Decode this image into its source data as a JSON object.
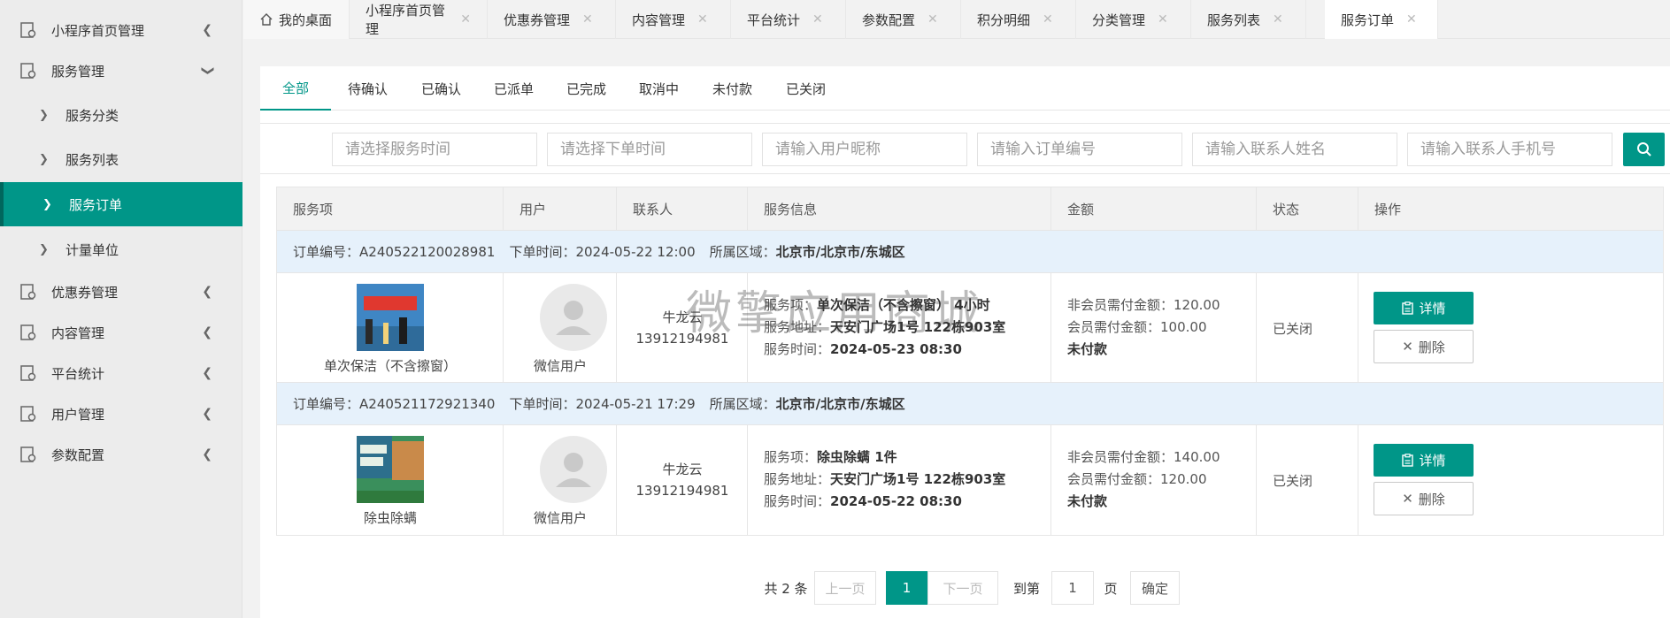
{
  "sidebar": {
    "items": [
      {
        "label": "小程序首页管理",
        "expanded": false
      },
      {
        "label": "服务管理",
        "expanded": true
      },
      {
        "label": "优惠券管理",
        "expanded": false
      },
      {
        "label": "内容管理",
        "expanded": false
      },
      {
        "label": "平台统计",
        "expanded": false
      },
      {
        "label": "用户管理",
        "expanded": false
      },
      {
        "label": "参数配置",
        "expanded": false
      }
    ],
    "sub_items": [
      {
        "label": "服务分类"
      },
      {
        "label": "服务列表"
      },
      {
        "label": "服务订单",
        "active": true
      },
      {
        "label": "计量单位"
      }
    ]
  },
  "tabs": [
    {
      "label": "我的桌面",
      "home": true
    },
    {
      "label": "小程序首页管理"
    },
    {
      "label": "优惠券管理"
    },
    {
      "label": "内容管理"
    },
    {
      "label": "平台统计"
    },
    {
      "label": "参数配置"
    },
    {
      "label": "积分明细"
    },
    {
      "label": "分类管理"
    },
    {
      "label": "服务列表"
    },
    {
      "label": "服务订单",
      "active": true
    }
  ],
  "status_tabs": [
    "全部",
    "待确认",
    "已确认",
    "已派单",
    "已完成",
    "取消中",
    "未付款",
    "已关闭"
  ],
  "search": {
    "placeholders": [
      "请选择服务时间",
      "请选择下单时间",
      "请输入用户昵称",
      "请输入订单编号",
      "请输入联系人姓名",
      "请输入联系人手机号"
    ]
  },
  "table": {
    "headers": [
      "服务项",
      "用户",
      "联系人",
      "服务信息",
      "金额",
      "状态",
      "操作"
    ]
  },
  "orders": [
    {
      "order_no_label": "订单编号：",
      "order_no": "A240522120028981",
      "order_time_label": "下单时间：",
      "order_time": "2024-05-22 12:00",
      "region_label": "所属区域：",
      "region": "北京市/北京市/东城区",
      "service_name": "单次保洁（不含擦窗）",
      "user_name": "微信用户",
      "contact_name": "牛龙云",
      "contact_phone": "13912194981",
      "svc_item_label": "服务项：",
      "svc_item": "单次保洁（不含擦窗）  4小时",
      "svc_addr_label": "服务地址：",
      "svc_addr": "天安门广场1号  122栋903室",
      "svc_time_label": "服务时间：",
      "svc_time": "2024-05-23 08:30",
      "non_member_label": "非会员需付金额：",
      "non_member": "120.00",
      "member_label": "会员需付金额：",
      "member": "100.00",
      "pay_status": "未付款",
      "status": "已关闭",
      "detail_label": "详情",
      "delete_label": "删除"
    },
    {
      "order_no_label": "订单编号：",
      "order_no": "A240521172921340",
      "order_time_label": "下单时间：",
      "order_time": "2024-05-21 17:29",
      "region_label": "所属区域：",
      "region": "北京市/北京市/东城区",
      "service_name": "除虫除螨",
      "user_name": "微信用户",
      "contact_name": "牛龙云",
      "contact_phone": "13912194981",
      "svc_item_label": "服务项：",
      "svc_item": "除虫除螨  1件",
      "svc_addr_label": "服务地址：",
      "svc_addr": "天安门广场1号  122栋903室",
      "svc_time_label": "服务时间：",
      "svc_time": "2024-05-22 08:30",
      "non_member_label": "非会员需付金额：",
      "non_member": "140.00",
      "member_label": "会员需付金额：",
      "member": "120.00",
      "pay_status": "未付款",
      "status": "已关闭",
      "detail_label": "详情",
      "delete_label": "删除"
    }
  ],
  "pagination": {
    "total": "共 2 条",
    "prev": "上一页",
    "current": "1",
    "next": "下一页",
    "goto_label": "到第",
    "goto_value": "1",
    "page_unit": "页",
    "confirm": "确定"
  },
  "watermark": "微擎应用商城",
  "colors": {
    "accent": "#009688",
    "order_head_bg": "#e6f1fb"
  }
}
